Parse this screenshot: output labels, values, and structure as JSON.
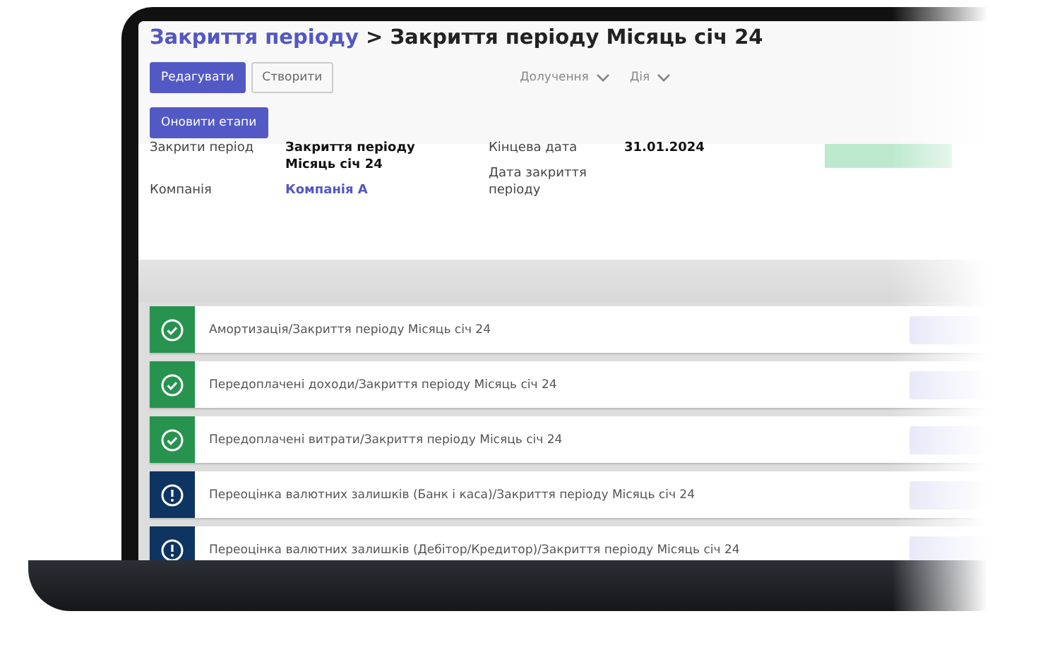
{
  "breadcrumb": {
    "parent": "Закриття періоду",
    "separator": ">",
    "current": "Закриття періоду Місяць січ 24"
  },
  "toolbar": {
    "buttons": [
      {
        "label": "Редагувати",
        "kind": "primary"
      },
      {
        "label": "Створити",
        "kind": "secondary"
      }
    ],
    "menus": [
      {
        "label": "Долучення"
      },
      {
        "label": "Дія"
      }
    ]
  },
  "action_button": {
    "label": "Оновити етапи"
  },
  "form": {
    "left": [
      {
        "label": "Закрити період",
        "value": "Закриття періоду Місяць січ 24",
        "kind": "text"
      },
      {
        "label": "Компанія",
        "value": "Компанія А",
        "kind": "link"
      }
    ],
    "right": [
      {
        "label": "Кінцева дата",
        "value": "31.01.2024"
      },
      {
        "label": "Дата закриття періоду"
      }
    ]
  },
  "stages": [
    {
      "name": "Амортизація/Закриття періоду Місяць січ 24",
      "kind": "done"
    },
    {
      "name": "Передоплачені доходи/Закриття періоду Місяць січ 24",
      "kind": "done"
    },
    {
      "name": "Передоплачені витрати/Закриття періоду Місяць січ 24",
      "kind": "done"
    },
    {
      "name": "Переоцінка валютних залишків (Банк і каса)/Закриття періоду Місяць січ 24",
      "kind": "pending"
    },
    {
      "name": "Переоцінка валютних залишків (Дебітор/Кредитор)/Закриття періоду Місяць січ 24",
      "kind": "pending"
    }
  ]
}
